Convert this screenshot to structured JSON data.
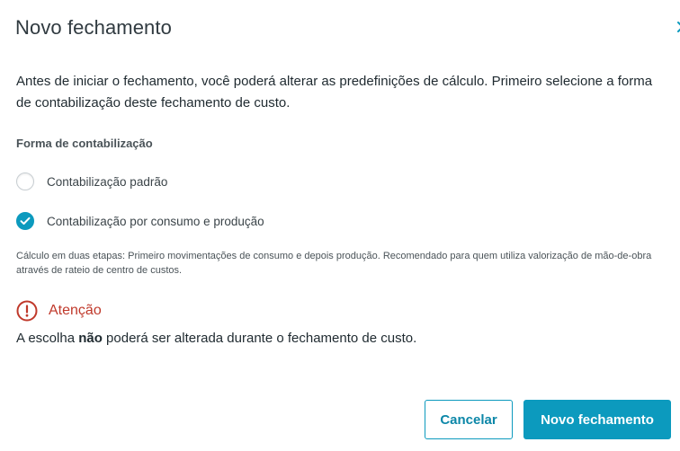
{
  "dialog": {
    "title": "Novo fechamento",
    "intro": "Antes de iniciar o fechamento, você poderá alterar as predefinições de cálculo. Primeiro selecione a forma de contabilização deste fechamento de custo.",
    "section_label": "Forma de contabilização",
    "options": [
      {
        "label": "Contabilização padrão",
        "checked": false
      },
      {
        "label": "Contabilização por consumo e produção",
        "checked": true
      }
    ],
    "hint": "Cálculo em duas etapas: Primeiro movimentações de consumo e depois produção. Recomendado para quem utiliza valorização de mão-de-obra através de rateio de centro de custos.",
    "attention_title": "Atenção",
    "note_before": "A escolha ",
    "note_bold": "não",
    "note_after": " poderá ser alterada durante o fechamento de custo.",
    "cancel_label": "Cancelar",
    "confirm_label": "Novo fechamento"
  },
  "colors": {
    "accent": "#0c9abe",
    "warning": "#c0392b",
    "text": "#1f2a30"
  },
  "icons": {
    "close": "close-icon",
    "checked": "check-icon",
    "attention": "alert-circle-icon"
  }
}
